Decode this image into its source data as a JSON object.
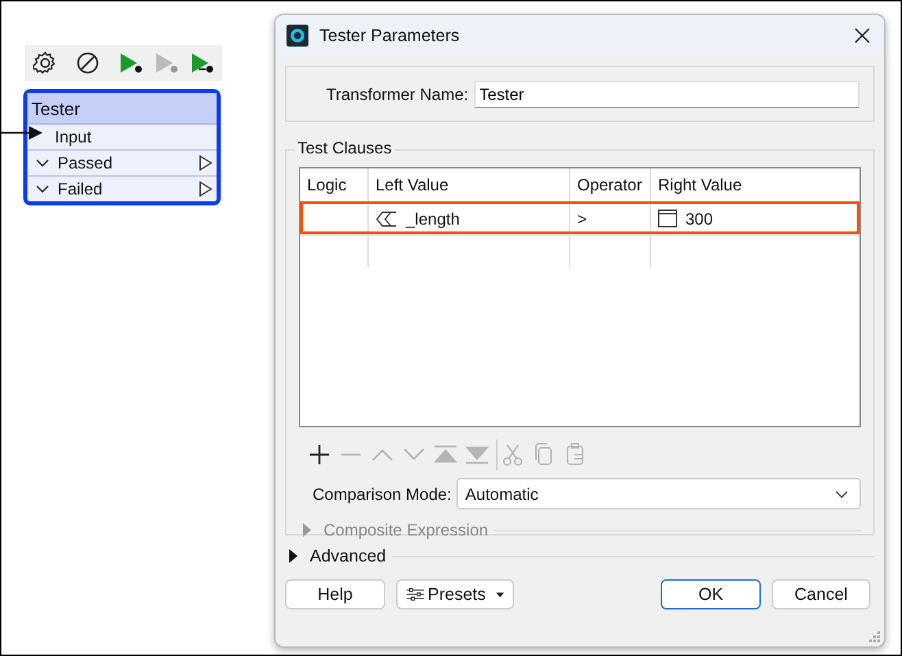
{
  "canvas": {
    "toolbar": [
      {
        "kind": "settings",
        "disabled": false
      },
      {
        "kind": "disable",
        "disabled": false
      },
      {
        "kind": "run",
        "disabled": false
      },
      {
        "kind": "run",
        "disabled": true
      },
      {
        "kind": "run-to",
        "disabled": false
      }
    ],
    "node": {
      "title": "Tester",
      "selected": true,
      "ports": [
        {
          "kind": "input",
          "label": "Input"
        },
        {
          "kind": "output",
          "label": "Passed"
        },
        {
          "kind": "output",
          "label": "Failed"
        }
      ]
    }
  },
  "dialog": {
    "title": "Tester Parameters",
    "transformer_name": {
      "label": "Transformer Name:",
      "value": "Tester"
    },
    "test_clauses": {
      "title": "Test Clauses",
      "columns": [
        "Logic",
        "Left Value",
        "Operator",
        "Right Value"
      ],
      "rows": [
        {
          "left_value": "_length",
          "operator": ">",
          "right_value": "300",
          "selected": true
        }
      ],
      "toolbar": [
        {
          "kind": "add",
          "disabled": false
        },
        {
          "kind": "remove",
          "disabled": true
        },
        {
          "kind": "up",
          "disabled": true
        },
        {
          "kind": "down",
          "disabled": true
        },
        {
          "kind": "top",
          "disabled": true
        },
        {
          "kind": "bottom",
          "disabled": true
        },
        {
          "kind": "cut",
          "disabled": true
        },
        {
          "kind": "copy",
          "disabled": true
        },
        {
          "kind": "paste",
          "disabled": true
        }
      ],
      "comparison_mode": {
        "label": "Comparison Mode:",
        "value": "Automatic"
      },
      "composite_expression": {
        "label": "Composite Expression",
        "expanded": false,
        "disabled": true
      }
    },
    "advanced": {
      "label": "Advanced",
      "expanded": false
    },
    "buttons": [
      {
        "kind": "help",
        "label": "Help"
      },
      {
        "kind": "presets",
        "label": "Presets"
      },
      {
        "kind": "ok",
        "label": "OK"
      },
      {
        "kind": "cancel",
        "label": "Cancel"
      }
    ]
  }
}
